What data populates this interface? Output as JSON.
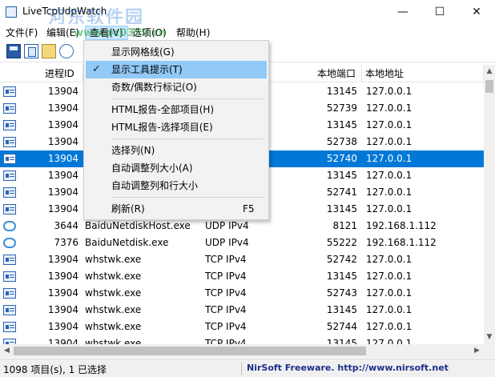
{
  "window": {
    "title": "LiveTcpUdpWatch",
    "watermark": "河东软件园",
    "watermark_url": "www.pc0359.cn"
  },
  "menubar": {
    "items": [
      "文件(F)",
      "编辑(E)",
      "查看(V)",
      "选项(O)",
      "帮助(H)"
    ],
    "active": "查看(V)"
  },
  "header": {
    "columns": [
      "进程ID",
      "本地端口",
      "本地地址"
    ]
  },
  "rows": [
    {
      "icon": "tcp-icon",
      "pid": "13904",
      "name": "",
      "protocol": "",
      "port": "13145",
      "address": "127.0.0.1"
    },
    {
      "icon": "tcp-icon",
      "pid": "13904",
      "name": "",
      "protocol": "",
      "port": "52739",
      "address": "127.0.0.1"
    },
    {
      "icon": "tcp-icon",
      "pid": "13904",
      "name": "",
      "protocol": "",
      "port": "13145",
      "address": "127.0.0.1"
    },
    {
      "icon": "tcp-icon",
      "pid": "13904",
      "name": "",
      "protocol": "",
      "port": "52738",
      "address": "127.0.0.1"
    },
    {
      "icon": "tcp-icon",
      "pid": "13904",
      "name": "",
      "protocol": "",
      "port": "52740",
      "address": "127.0.0.1",
      "selected": true
    },
    {
      "icon": "tcp-icon",
      "pid": "13904",
      "name": "",
      "protocol": "",
      "port": "13145",
      "address": "127.0.0.1"
    },
    {
      "icon": "tcp-icon",
      "pid": "13904",
      "name": "",
      "protocol": "",
      "port": "52741",
      "address": "127.0.0.1"
    },
    {
      "icon": "tcp-icon",
      "pid": "13904",
      "name": "",
      "protocol": "",
      "port": "13145",
      "address": "127.0.0.1"
    },
    {
      "icon": "udp-icon",
      "pid": "3644",
      "name": "BaiduNetdiskHost.exe",
      "protocol": "UDP IPv4",
      "port": "8121",
      "address": "192.168.1.112"
    },
    {
      "icon": "udp-icon",
      "pid": "7376",
      "name": "BaiduNetdisk.exe",
      "protocol": "UDP IPv4",
      "port": "55222",
      "address": "192.168.1.112"
    },
    {
      "icon": "tcp-icon",
      "pid": "13904",
      "name": "whstwk.exe",
      "protocol": "TCP IPv4",
      "port": "52742",
      "address": "127.0.0.1"
    },
    {
      "icon": "tcp-icon",
      "pid": "13904",
      "name": "whstwk.exe",
      "protocol": "TCP IPv4",
      "port": "13145",
      "address": "127.0.0.1"
    },
    {
      "icon": "tcp-icon",
      "pid": "13904",
      "name": "whstwk.exe",
      "protocol": "TCP IPv4",
      "port": "52743",
      "address": "127.0.0.1"
    },
    {
      "icon": "tcp-icon",
      "pid": "13904",
      "name": "whstwk.exe",
      "protocol": "TCP IPv4",
      "port": "13145",
      "address": "127.0.0.1"
    },
    {
      "icon": "tcp-icon",
      "pid": "13904",
      "name": "whstwk.exe",
      "protocol": "TCP IPv4",
      "port": "52744",
      "address": "127.0.0.1"
    },
    {
      "icon": "tcp-icon",
      "pid": "13904",
      "name": "whstwk.exe",
      "protocol": "TCP IPv4",
      "port": "13145",
      "address": "127.0.0.1"
    }
  ],
  "view_menu": {
    "items": [
      {
        "label": "显示网格线(G)",
        "checked": false,
        "shortcut": ""
      },
      {
        "label": "显示工具提示(T)",
        "checked": true,
        "shortcut": ""
      },
      {
        "label": "奇数/偶数行标记(O)",
        "checked": false,
        "shortcut": ""
      },
      {
        "label": "HTML报告-全部项目(H)",
        "checked": false,
        "shortcut": ""
      },
      {
        "label": "HTML报告-选择项目(E)",
        "checked": false,
        "shortcut": ""
      },
      {
        "label": "选择列(N)",
        "checked": false,
        "shortcut": ""
      },
      {
        "label": "自动调整列大小(A)",
        "checked": false,
        "shortcut": ""
      },
      {
        "label": "自动调整列和行大小",
        "checked": false,
        "shortcut": ""
      },
      {
        "label": "刷新(R)",
        "checked": false,
        "shortcut": "F5"
      }
    ],
    "check_glyph": "✓"
  },
  "statusbar": {
    "left": "1098 项目(s), 1 已选择",
    "right": "NirSoft Freeware.  http://www.nirsoft.net"
  },
  "colors": {
    "selection": "#0078d7",
    "menu_hover": "#91c9f7",
    "status_link": "#1c2f8a"
  }
}
